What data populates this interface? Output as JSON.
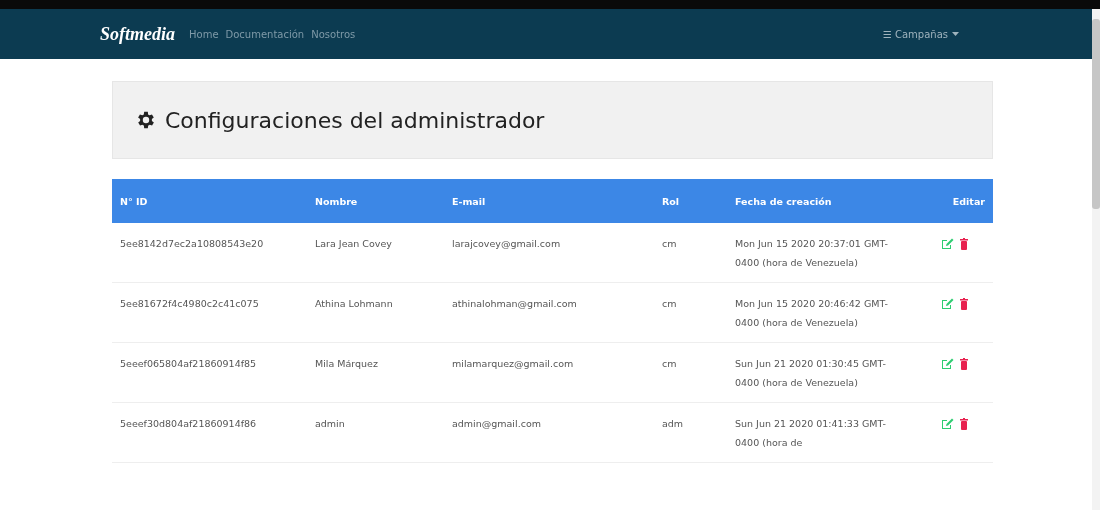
{
  "navbar": {
    "brand": "Softmedia",
    "links": [
      "Home",
      "Documentación",
      "Nosotros"
    ],
    "menu": {
      "icon": "☰",
      "label": "Campañas"
    }
  },
  "header": {
    "title": "Configuraciones del administrador"
  },
  "table": {
    "columns": [
      "N° ID",
      "Nombre",
      "E-mail",
      "Rol",
      "Fecha de creación",
      "Editar"
    ],
    "rows": [
      {
        "id": "5ee8142d7ec2a10808543e20",
        "name": "Lara Jean Covey",
        "email": "larajcovey@gmail.com",
        "role": "cm",
        "created": "Mon Jun 15 2020 20:37:01 GMT-0400 (hora de Venezuela)"
      },
      {
        "id": "5ee81672f4c4980c2c41c075",
        "name": "Athina Lohmann",
        "email": "athinalohman@gmail.com",
        "role": "cm",
        "created": "Mon Jun 15 2020 20:46:42 GMT-0400 (hora de Venezuela)"
      },
      {
        "id": "5eeef065804af21860914f85",
        "name": "Mila Márquez",
        "email": "milamarquez@gmail.com",
        "role": "cm",
        "created": "Sun Jun 21 2020 01:30:45 GMT-0400 (hora de Venezuela)"
      },
      {
        "id": "5eeef30d804af21860914f86",
        "name": "admin",
        "email": "admin@gmail.com",
        "role": "adm",
        "created": "Sun Jun 21 2020 01:41:33 GMT-0400 (hora de"
      }
    ]
  }
}
